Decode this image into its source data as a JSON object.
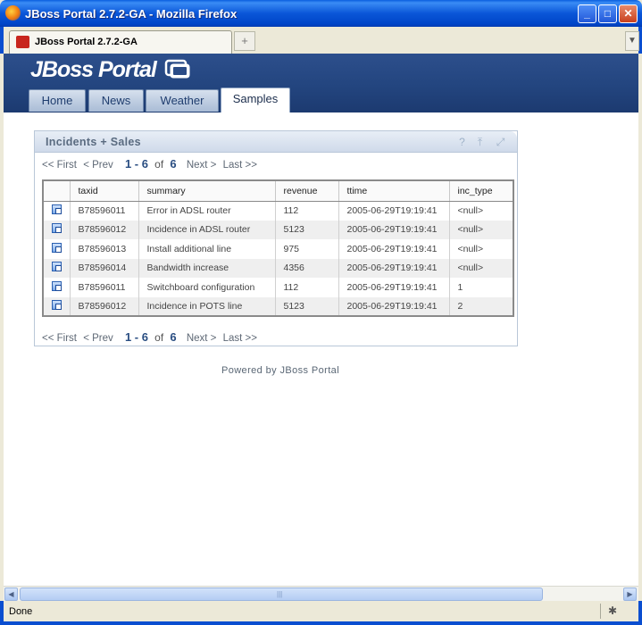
{
  "window": {
    "title": "JBoss Portal 2.7.2-GA - Mozilla Firefox",
    "buttons": {
      "minimize": "_",
      "maximize": "□",
      "close": "✕"
    }
  },
  "browser": {
    "tab_label": "JBoss Portal 2.7.2-GA",
    "new_tab_symbol": "+",
    "tab_scroll_symbol": "▼",
    "status": "Done"
  },
  "portal": {
    "logo_text": "JBoss Portal",
    "nav": [
      {
        "label": "Home",
        "active": false
      },
      {
        "label": "News",
        "active": false
      },
      {
        "label": "Weather",
        "active": false
      },
      {
        "label": "Samples",
        "active": true
      }
    ],
    "footer": "Powered by JBoss Portal"
  },
  "portlet": {
    "title": "Incidents + Sales",
    "icons": [
      "help-icon",
      "maximize-icon",
      "restore-icon"
    ],
    "pager": {
      "first": "<< First",
      "prev": "< Prev",
      "range": "1 - 6",
      "of": "of",
      "total": "6",
      "next": "Next >",
      "last": "Last >>"
    },
    "table": {
      "columns": [
        "taxid",
        "summary",
        "revenue",
        "ttime",
        "inc_type"
      ],
      "rows": [
        [
          "B78596011",
          "Error in ADSL router",
          "112",
          "2005-06-29T19:19:41",
          "<null>"
        ],
        [
          "B78596012",
          "Incidence in ADSL router",
          "5123",
          "2005-06-29T19:19:41",
          "<null>"
        ],
        [
          "B78596013",
          "Install additional line",
          "975",
          "2005-06-29T19:19:41",
          "<null>"
        ],
        [
          "B78596014",
          "Bandwidth increase",
          "4356",
          "2005-06-29T19:19:41",
          "<null>"
        ],
        [
          "B78596011",
          "Switchboard configuration",
          "112",
          "2005-06-29T19:19:41",
          "1"
        ],
        [
          "B78596012",
          "Incidence in POTS line",
          "5123",
          "2005-06-29T19:19:41",
          "2"
        ]
      ]
    }
  }
}
